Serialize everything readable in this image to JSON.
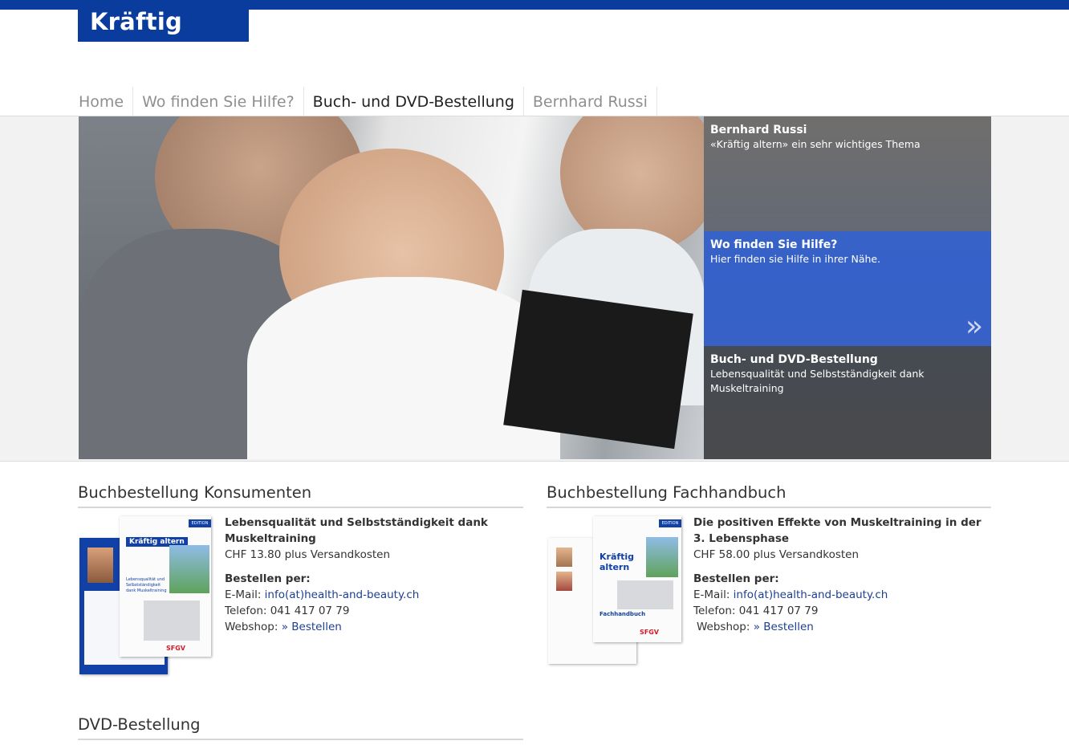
{
  "header": {
    "logo": "Kräftig altern"
  },
  "nav": {
    "items": [
      {
        "label": "Home"
      },
      {
        "label": "Wo finden Sie Hilfe?"
      },
      {
        "label": "Buch- und DVD-Bestellung",
        "active": true
      },
      {
        "label": "Bernhard Russi"
      }
    ]
  },
  "hero": {
    "panels": [
      {
        "title": "Bernhard Russi",
        "subtitle": "«Kräftig altern» ein sehr wichtiges Thema"
      },
      {
        "title": "Wo finden Sie Hilfe?",
        "subtitle": "Hier finden sie Hilfe in ihrer Nähe.",
        "arrow": "»"
      },
      {
        "title": "Buch- und DVD-Bestellung",
        "subtitle": "Lebensqualität und Selbstständigkeit dank Muskeltraining"
      }
    ]
  },
  "konsumenten": {
    "heading": "Buchbestellung Konsumenten",
    "title": "Lebensqualität und Selbstständigkeit dank Muskeltraining",
    "price": "CHF 13.80 plus Versandkosten",
    "order_label": "Bestellen per:",
    "email_label": "E-Mail:",
    "email": "info(at)health-and-beauty.ch",
    "phone": "Telefon: 041 417 07 79",
    "webshop_label": "Webshop:",
    "webshop_link": "» Bestellen",
    "cover": {
      "tag": "EDITION",
      "title": "Kräftig altern",
      "subtitle": "Lebensqualität und Selbstständigkeit dank Muskeltraining",
      "brand": "SFGV"
    }
  },
  "fachhandbuch": {
    "heading": "Buchbestellung Fachhandbuch",
    "title": "Die positiven Effekte von Muskeltraining in der 3. Lebensphase",
    "price": "CHF 58.00 plus Versandkosten",
    "order_label": "Bestellen per:",
    "email_label": "E-Mail:",
    "email": "info(at)health-and-beauty.ch",
    "phone": "Telefon: 041 417 07 79",
    "webshop_label": "Webshop:",
    "webshop_link": "» Bestellen",
    "cover": {
      "tag": "EDITION",
      "title": "Kräftig altern",
      "subtitle": "Fachhandbuch",
      "brand": "SFGV"
    }
  },
  "dvd": {
    "heading": "DVD-Bestellung"
  },
  "colors": {
    "brand_blue": "#0a3c9e",
    "link_blue": "#1c3f94",
    "panel_blue": "#2c5ac8"
  }
}
